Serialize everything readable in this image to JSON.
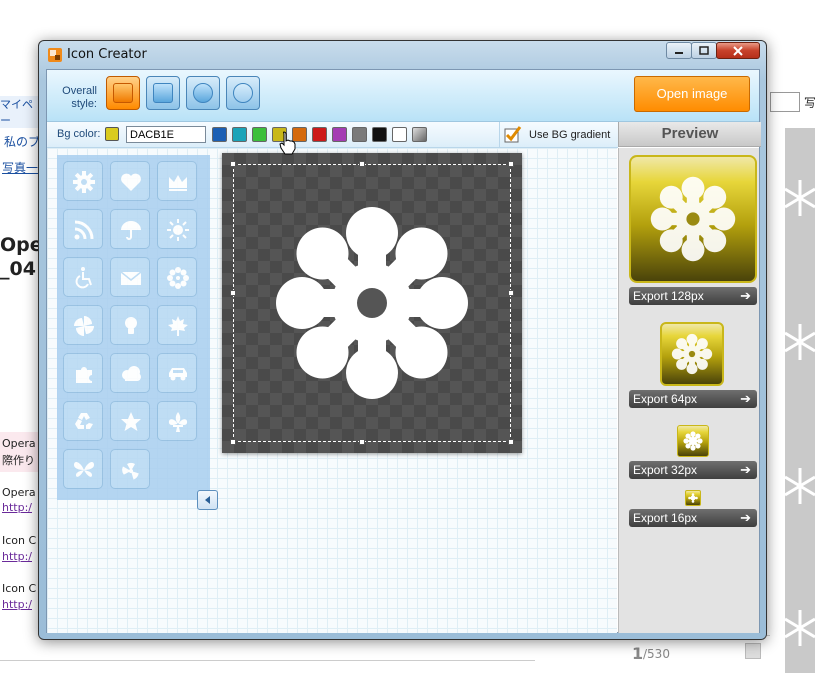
{
  "background_page": {
    "nav_link_1": "マイペー",
    "nav_link_2": "私のブ",
    "nav_link_3": "写真一",
    "heading_1": "Ope",
    "heading_2": "_04",
    "comment_1a": "Opera",
    "comment_1b": "際作り",
    "comment_2": "Opera",
    "link_1": "http:/",
    "comment_3": "Icon C",
    "link_2": "http:/",
    "comment_4": "Icon C",
    "link_3": "http:/",
    "pager": "1",
    "pager_total": "/530",
    "right_input_char": "写"
  },
  "window": {
    "title": "Icon Creator"
  },
  "toolbar": {
    "overall_style_label": "Overall style:",
    "style_buttons": [
      "glossy-square",
      "flat-square",
      "glossy-round",
      "flat-round"
    ],
    "open_image_label": "Open image"
  },
  "colorbar": {
    "bg_color_label": "Bg color:",
    "hex_value": "DACB1E",
    "current_color": "#DACB1E",
    "swatches": [
      "#1a5fb4",
      "#1aa3b8",
      "#3cbf3c",
      "#c9b81a",
      "#d46a0e",
      "#cc1a1a",
      "#a43cb3",
      "#7a7a7a",
      "#111111",
      "#ffffff",
      "#9a9a9a"
    ],
    "use_bg_gradient_label": "Use BG gradient",
    "use_bg_gradient": true
  },
  "preview": {
    "title": "Preview",
    "export_128": "Export 128px",
    "export_64": "Export 64px",
    "export_32": "Export 32px",
    "export_16": "Export 16px"
  },
  "icon_library": [
    "gear-icon",
    "heart-icon",
    "crown-icon",
    "rss-icon",
    "umbrella-icon",
    "sun-icon",
    "wheelchair-icon",
    "envelope-icon",
    "snowflake-icon",
    "pinwheel-icon",
    "lightbulb-icon",
    "maple-leaf-icon",
    "puzzle-icon",
    "cloud-icon",
    "car-icon",
    "recycle-icon",
    "star-icon",
    "fleur-de-lis-icon",
    "butterfly-icon",
    "radiation-icon"
  ]
}
